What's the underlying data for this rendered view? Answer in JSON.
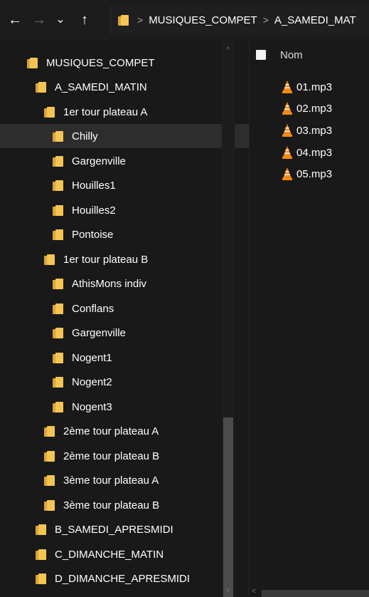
{
  "nav": {
    "back_icon": "←",
    "forward_icon": "→",
    "recent_icon": "⌄",
    "up_icon": "↑"
  },
  "address": {
    "separator": ">",
    "crumbs": [
      "MUSIQUES_COMPET",
      "A_SAMEDI_MAT"
    ]
  },
  "tree": {
    "items": [
      {
        "label": "MUSIQUES_COMPET"
      },
      {
        "label": "A_SAMEDI_MATIN"
      },
      {
        "label": "1er tour plateau A"
      },
      {
        "label": "Chilly",
        "selected": true
      },
      {
        "label": "Gargenville"
      },
      {
        "label": "Houilles1"
      },
      {
        "label": "Houilles2"
      },
      {
        "label": "Pontoise"
      },
      {
        "label": "1er tour plateau B"
      },
      {
        "label": "AthisMons indiv"
      },
      {
        "label": "Conflans"
      },
      {
        "label": "Gargenville"
      },
      {
        "label": "Nogent1"
      },
      {
        "label": "Nogent2"
      },
      {
        "label": "Nogent3"
      },
      {
        "label": "2ème tour plateau A"
      },
      {
        "label": "2ème tour plateau B"
      },
      {
        "label": "3ème tour plateau A"
      },
      {
        "label": "3ème tour plateau B"
      },
      {
        "label": "B_SAMEDI_APRESMIDI"
      },
      {
        "label": "C_DIMANCHE_MATIN"
      },
      {
        "label": "D_DIMANCHE_APRESMIDI"
      }
    ],
    "scroll_up_icon": "^",
    "scroll_down_icon": "v"
  },
  "content": {
    "column_header": "Nom",
    "files": [
      "01.mp3",
      "02.mp3",
      "03.mp3",
      "04.mp3",
      "05.mp3"
    ],
    "hscroll_left_icon": "<"
  },
  "colors": {
    "background": "#191919",
    "folder": "#f4c552",
    "selected_row": "#2d2d2d",
    "vlc_orange": "#f28a14"
  }
}
